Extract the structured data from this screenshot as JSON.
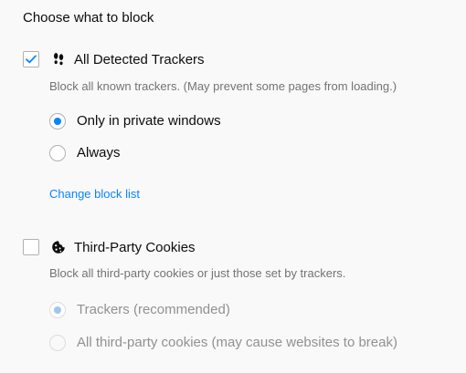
{
  "heading": "Choose what to block",
  "trackers": {
    "label": "All Detected Trackers",
    "checked": true,
    "icon": "footprints-icon",
    "description": "Block all known trackers. (May prevent some pages from loading.)",
    "options": [
      {
        "label": "Only in private windows",
        "selected": true,
        "disabled": false
      },
      {
        "label": "Always",
        "selected": false,
        "disabled": false
      }
    ],
    "link": "Change block list"
  },
  "cookies": {
    "label": "Third-Party Cookies",
    "checked": false,
    "icon": "cookie-icon",
    "description": "Block all third-party cookies or just those set by trackers.",
    "options": [
      {
        "label": "Trackers (recommended)",
        "selected": true,
        "disabled": true
      },
      {
        "label": "All third-party cookies (may cause websites to break)",
        "selected": false,
        "disabled": true
      }
    ]
  },
  "colors": {
    "accent": "#0a84ff",
    "text": "#0c0c0d",
    "muted": "#737373",
    "disabled_text": "#919192",
    "background": "#f9f9fa"
  }
}
